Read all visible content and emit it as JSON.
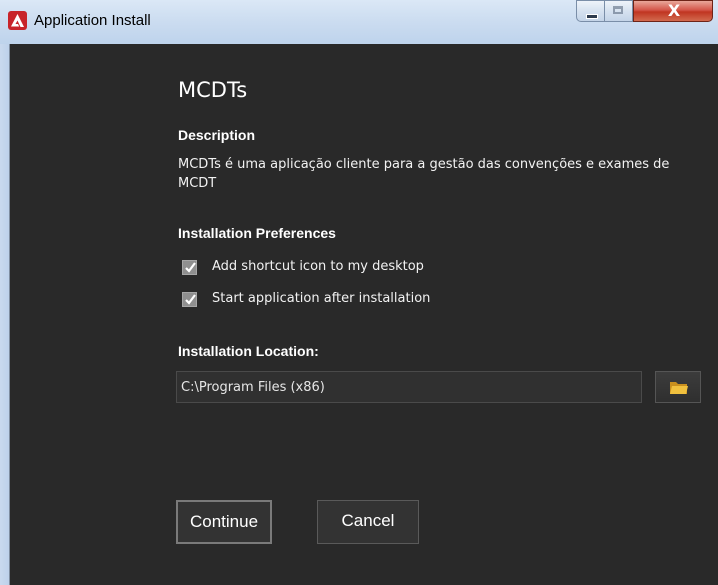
{
  "window": {
    "title": "Application Install",
    "close_glyph": "X"
  },
  "app": {
    "name": "MCDTs"
  },
  "description": {
    "heading": "Description",
    "text": "MCDTs é uma aplicação cliente para a gestão das convenções e exames de MCDT"
  },
  "preferences": {
    "heading": "Installation Preferences",
    "items": [
      {
        "label": "Add shortcut icon to my desktop",
        "checked": true
      },
      {
        "label": "Start application after installation",
        "checked": true
      }
    ]
  },
  "location": {
    "heading": "Installation Location:",
    "value": "C:\\Program Files (x86)",
    "browse_icon": "folder-icon"
  },
  "buttons": {
    "continue": "Continue",
    "cancel": "Cancel"
  },
  "colors": {
    "background": "#292929",
    "logo": "#c8242a",
    "folder": "#e8b43c"
  }
}
